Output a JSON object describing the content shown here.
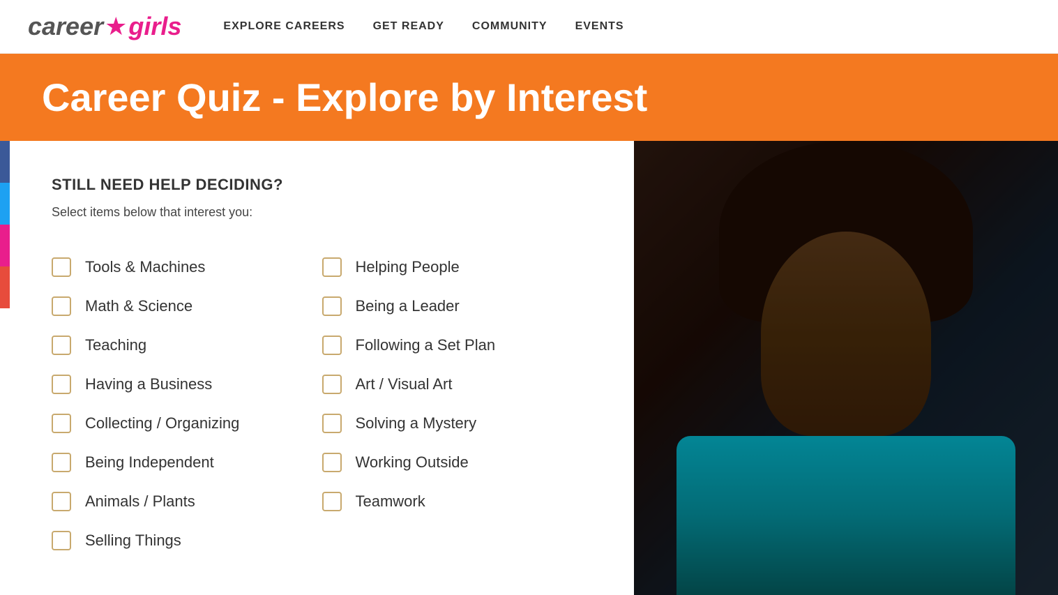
{
  "header": {
    "logo": {
      "career": "career",
      "star": "★",
      "girls": "girls"
    },
    "nav": {
      "items": [
        {
          "label": "EXPLORE CAREERS"
        },
        {
          "label": "GET READY"
        },
        {
          "label": "COMMUNITY"
        },
        {
          "label": "EVENTS"
        }
      ]
    }
  },
  "banner": {
    "title": "Career Quiz - Explore by Interest"
  },
  "quiz": {
    "heading": "STILL NEED HELP DECIDING?",
    "subtitle": "Select items below that interest you:",
    "items_left": [
      {
        "label": "Tools & Machines"
      },
      {
        "label": "Math & Science"
      },
      {
        "label": "Teaching"
      },
      {
        "label": "Having a Business"
      },
      {
        "label": "Collecting / Organizing"
      },
      {
        "label": "Being Independent"
      },
      {
        "label": "Animals / Plants"
      },
      {
        "label": "Selling Things"
      }
    ],
    "items_right": [
      {
        "label": "Helping People"
      },
      {
        "label": "Being a Leader"
      },
      {
        "label": "Following a Set Plan"
      },
      {
        "label": "Art / Visual Art"
      },
      {
        "label": "Solving a Mystery"
      },
      {
        "label": "Working Outside"
      },
      {
        "label": "Teamwork"
      }
    ]
  },
  "colors": {
    "orange": "#f47920",
    "pink": "#e91e8c",
    "checkbox_border": "#c8a96e"
  }
}
